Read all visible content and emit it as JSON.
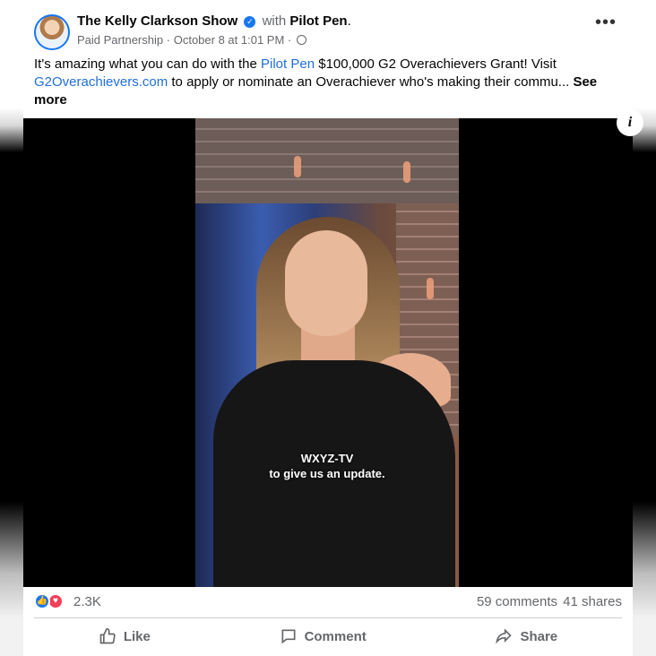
{
  "post": {
    "page_name": "The Kelly Clarkson Show",
    "with_text": "with",
    "partner_name": "Pilot Pen",
    "title_suffix": ".",
    "partnership_label": "Paid Partnership",
    "separator": "·",
    "date": "October 8 at 1:01 PM",
    "caption": {
      "part1": "It's amazing what you can do with the ",
      "link1": "Pilot Pen",
      "part2": " $100,000 G2 Overachievers Grant! Visit ",
      "link2": "G2Overachievers.com",
      "part3": " to apply or nominate an Overachiever who's making their commu... ",
      "see_more": "See more"
    }
  },
  "video": {
    "subtitle_line1": "WXYZ-TV",
    "subtitle_line2": "to give us an update.",
    "info_label": "i"
  },
  "engagement": {
    "reaction_count": "2.3K",
    "comments": "59 comments",
    "shares": "41 shares"
  },
  "actions": {
    "like": "Like",
    "comment": "Comment",
    "share": "Share"
  },
  "icons": {
    "verified": "verified-badge-icon",
    "globe": "globe-icon",
    "more": "more-options-icon",
    "info": "info-icon",
    "like_reaction": "like-reaction-icon",
    "love_reaction": "love-reaction-icon"
  },
  "colors": {
    "link": "#216fdb",
    "secondary_text": "#65676b",
    "like_blue": "#1877f2",
    "love_red": "#f33e58"
  }
}
